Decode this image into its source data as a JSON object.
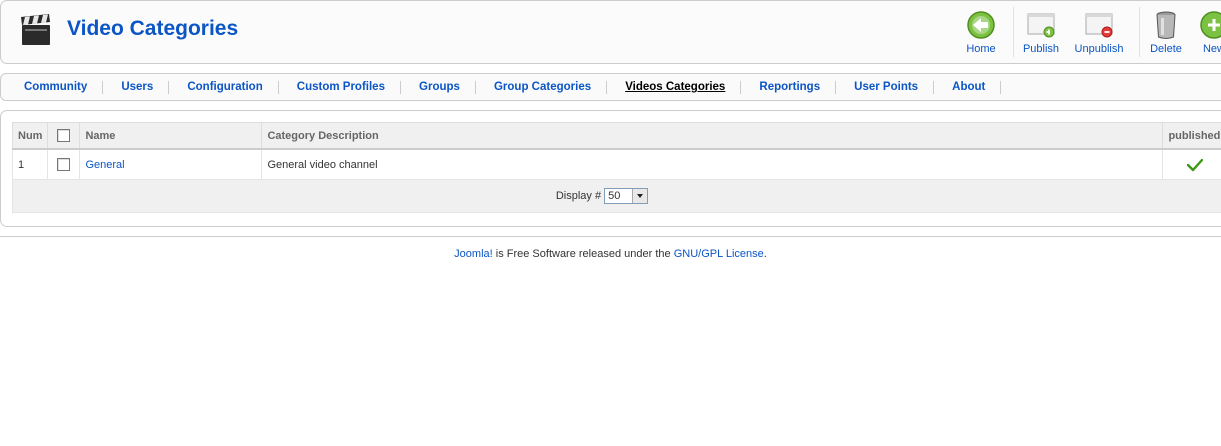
{
  "header": {
    "title": "Video Categories"
  },
  "toolbar": {
    "buttons": [
      {
        "label": "Home",
        "icon": "home-icon"
      },
      {
        "label": "Publish",
        "icon": "publish-icon"
      },
      {
        "label": "Unpublish",
        "icon": "unpublish-icon"
      },
      {
        "label": "Delete",
        "icon": "trash-icon"
      },
      {
        "label": "New",
        "icon": "new-icon"
      }
    ]
  },
  "submenu": {
    "items": [
      {
        "label": "Community"
      },
      {
        "label": "Users"
      },
      {
        "label": "Configuration"
      },
      {
        "label": "Custom Profiles"
      },
      {
        "label": "Groups"
      },
      {
        "label": "Group Categories"
      },
      {
        "label": "Videos Categories",
        "active": true
      },
      {
        "label": "Reportings"
      },
      {
        "label": "User Points"
      },
      {
        "label": "About"
      }
    ]
  },
  "table": {
    "headers": {
      "num": "Num",
      "name": "Name",
      "description": "Category Description",
      "published": "published"
    },
    "rows": [
      {
        "num": "1",
        "name": "General",
        "description": "General video channel",
        "published": true
      }
    ],
    "footer": {
      "display_label": "Display #",
      "display_value": "50"
    }
  },
  "footer": {
    "joomla_link": "Joomla!",
    "text": " is Free Software released under the ",
    "license_link": "GNU/GPL License",
    "suffix": "."
  },
  "colors": {
    "link": "#0b55c4",
    "published_check": "#3a9a12"
  }
}
